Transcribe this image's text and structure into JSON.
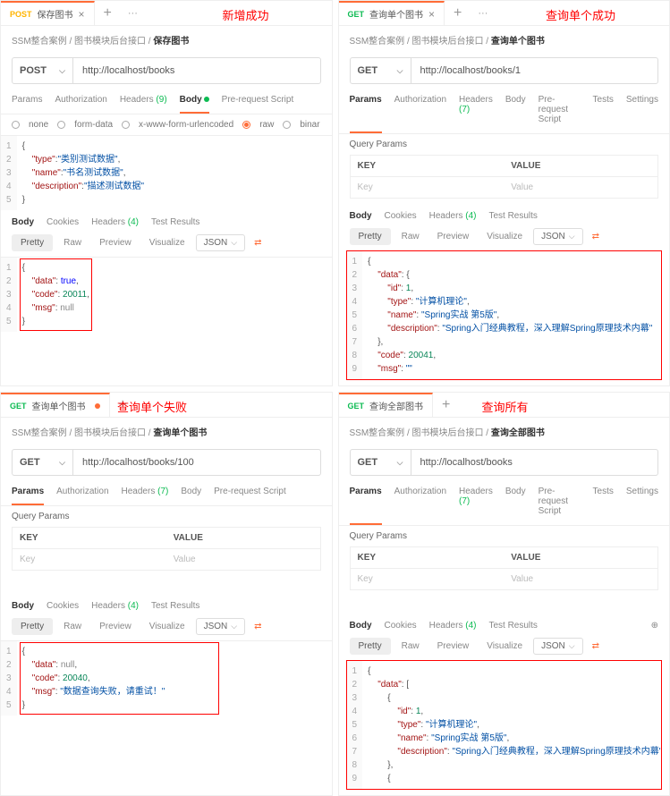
{
  "annot": {
    "p1": "新增成功",
    "p2": "查询单个成功",
    "p3": "查询单个失败",
    "p4": "查询所有"
  },
  "tabs": {
    "p1": {
      "method": "POST",
      "title": "保存图书"
    },
    "p2": {
      "method": "GET",
      "title": "查询单个图书"
    },
    "p3": {
      "method": "GET",
      "title": "查询单个图书"
    },
    "p4": {
      "method": "GET",
      "title": "查询全部图书"
    }
  },
  "crumb": {
    "base": "SSM整合案例 / 图书模块后台接口 / ",
    "p1": "保存图书",
    "p2": "查询单个图书",
    "p3": "查询单个图书",
    "p4": "查询全部图书"
  },
  "req": {
    "p1": {
      "method": "POST",
      "url": "http://localhost/books"
    },
    "p2": {
      "method": "GET",
      "url": "http://localhost/books/1"
    },
    "p3": {
      "method": "GET",
      "url": "http://localhost/books/100"
    },
    "p4": {
      "method": "GET",
      "url": "http://localhost/books"
    }
  },
  "reqtabs": {
    "params": "Params",
    "auth": "Authorization",
    "headers": "Headers",
    "h9": "(9)",
    "h7": "(7)",
    "body": "Body",
    "prs": "Pre-request Script",
    "tests": "Tests",
    "settings": "Settings"
  },
  "bodytypes": {
    "none": "none",
    "form": "form-data",
    "url": "x-www-form-urlencoded",
    "raw": "raw",
    "bin": "binar"
  },
  "queryParams": "Query Params",
  "kvhead": {
    "key": "KEY",
    "val": "VALUE"
  },
  "kvph": {
    "key": "Key",
    "val": "Value"
  },
  "resphead": {
    "body": "Body",
    "cookies": "Cookies",
    "headers": "Headers",
    "h4": "(4)",
    "tr": "Test Results"
  },
  "tools": {
    "pretty": "Pretty",
    "raw": "Raw",
    "preview": "Preview",
    "vis": "Visualize",
    "json": "JSON"
  },
  "reqbody": {
    "l1": "{",
    "l2_k": "\"type\"",
    "l2_v": "\"类别测试数据\"",
    "l3_k": "\"name\"",
    "l3_v": "\"书名测试数据\"",
    "l4_k": "\"description\"",
    "l4_v": "\"描述测试数据\"",
    "l5": "}"
  },
  "resp1": {
    "l1": "{",
    "l2_k": "\"data\"",
    "l2_v": "true",
    "l3_k": "\"code\"",
    "l3_v": "20011",
    "l4_k": "\"msg\"",
    "l4_v": "null",
    "l5": "}"
  },
  "resp2": {
    "l1": "{",
    "l2_k": "\"data\"",
    "l2_v": "{",
    "l3_k": "\"id\"",
    "l3_v": "1",
    "l4_k": "\"type\"",
    "l4_v": "\"计算机理论\"",
    "l5_k": "\"name\"",
    "l5_v": "\"Spring实战 第5版\"",
    "l6_k": "\"description\"",
    "l6_v": "\"Spring入门经典教程，深入理解Spring原理技术内幕\"",
    "l7": "}",
    "l8_k": "\"code\"",
    "l8_v": "20041",
    "l9_k": "\"msg\"",
    "l9_v": "\"\""
  },
  "resp3": {
    "l1": "{",
    "l2_k": "\"data\"",
    "l2_v": "null",
    "l3_k": "\"code\"",
    "l3_v": "20040",
    "l4_k": "\"msg\"",
    "l4_v": "\"数据查询失败，请重试！\"",
    "l5": "}"
  },
  "resp4": {
    "l1": "{",
    "l2_k": "\"data\"",
    "l2_v": "[",
    "l3": "{",
    "l4_k": "\"id\"",
    "l4_v": "1",
    "l5_k": "\"type\"",
    "l5_v": "\"计算机理论\"",
    "l6_k": "\"name\"",
    "l6_v": "\"Spring实战 第5版\"",
    "l7_k": "\"description\"",
    "l7_v": "\"Spring入门经典教程，深入理解Spring原理技术内幕\"",
    "l8": "},",
    "l9": "{"
  }
}
